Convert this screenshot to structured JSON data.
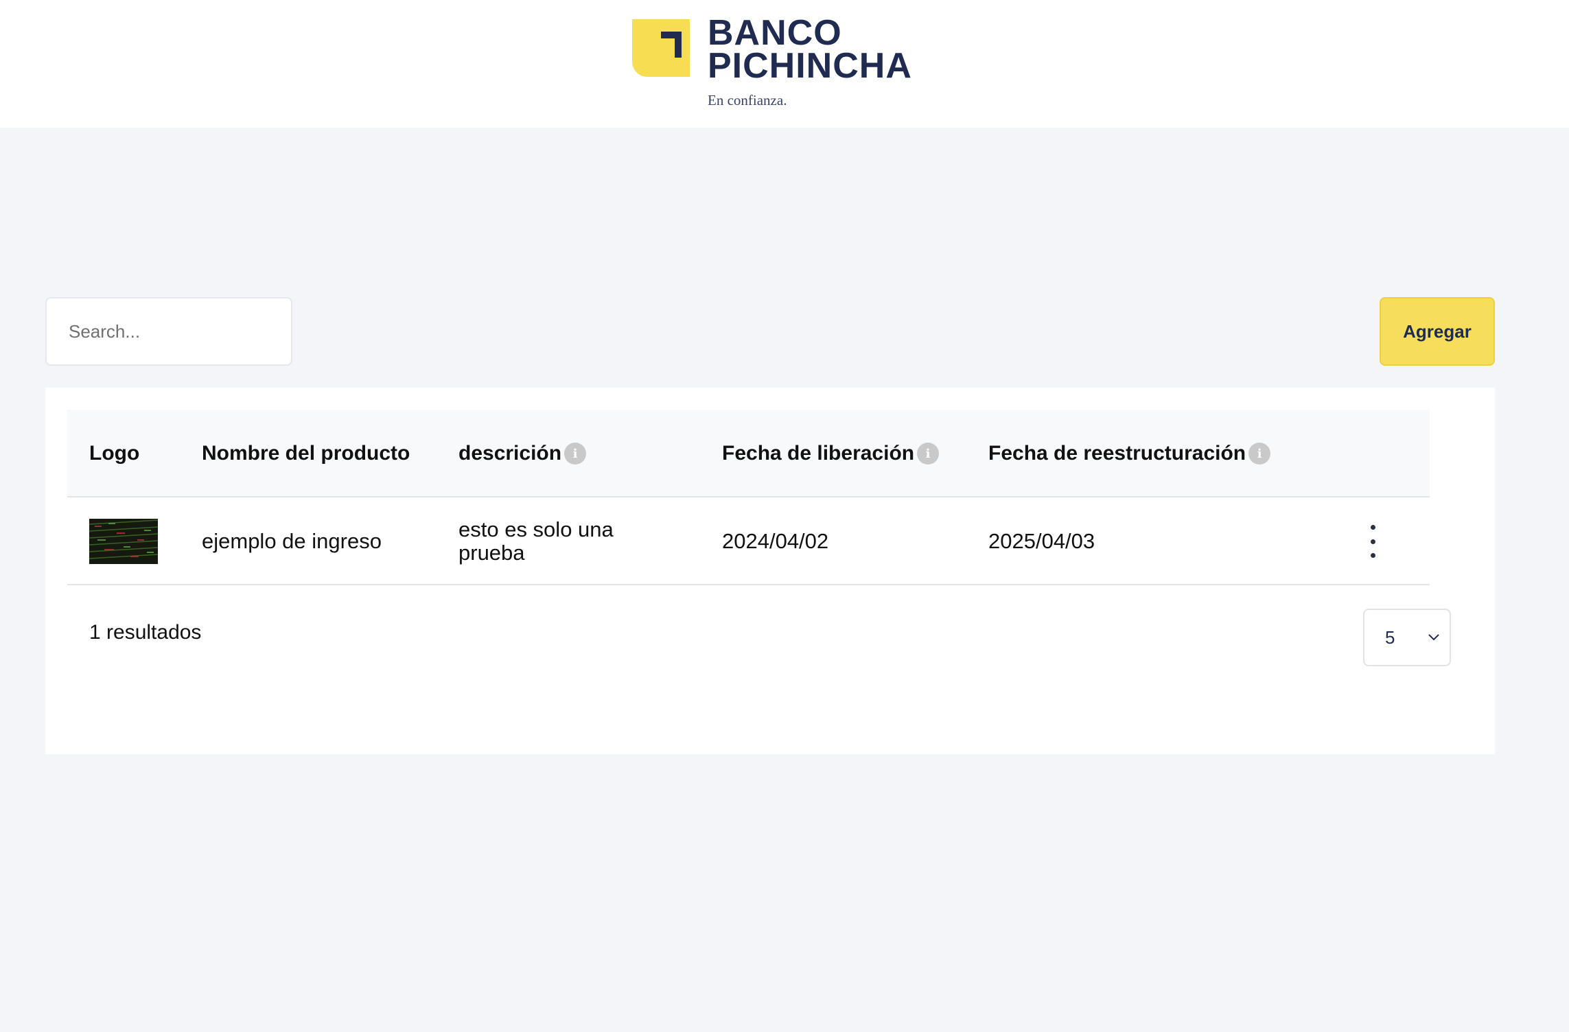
{
  "brand": {
    "name_line1": "BANCO",
    "name_line2": "PICHINCHA",
    "tagline": "En confianza.",
    "accent_color": "#f6dd52",
    "text_color": "#1f2b51"
  },
  "toolbar": {
    "search_placeholder": "Search...",
    "search_value": "",
    "add_label": "Agregar"
  },
  "table": {
    "columns": [
      {
        "label": "Logo",
        "info_icon": false
      },
      {
        "label": "Nombre del producto",
        "info_icon": false
      },
      {
        "label": "descrición",
        "info_icon": true
      },
      {
        "label": "Fecha de liberación",
        "info_icon": true
      },
      {
        "label": "Fecha de reestructuración",
        "info_icon": true
      }
    ],
    "rows": [
      {
        "logo": "thumbnail-image",
        "name": "ejemplo de ingreso",
        "description": "esto es solo una prueba",
        "release_date": "2024/04/02",
        "restructure_date": "2025/04/03"
      }
    ]
  },
  "footer": {
    "results_text": "1 resultados",
    "page_size": "5"
  },
  "icons": {
    "info": "info-icon",
    "menu": "kebab-menu-icon",
    "dropdown": "chevron-down-icon"
  }
}
